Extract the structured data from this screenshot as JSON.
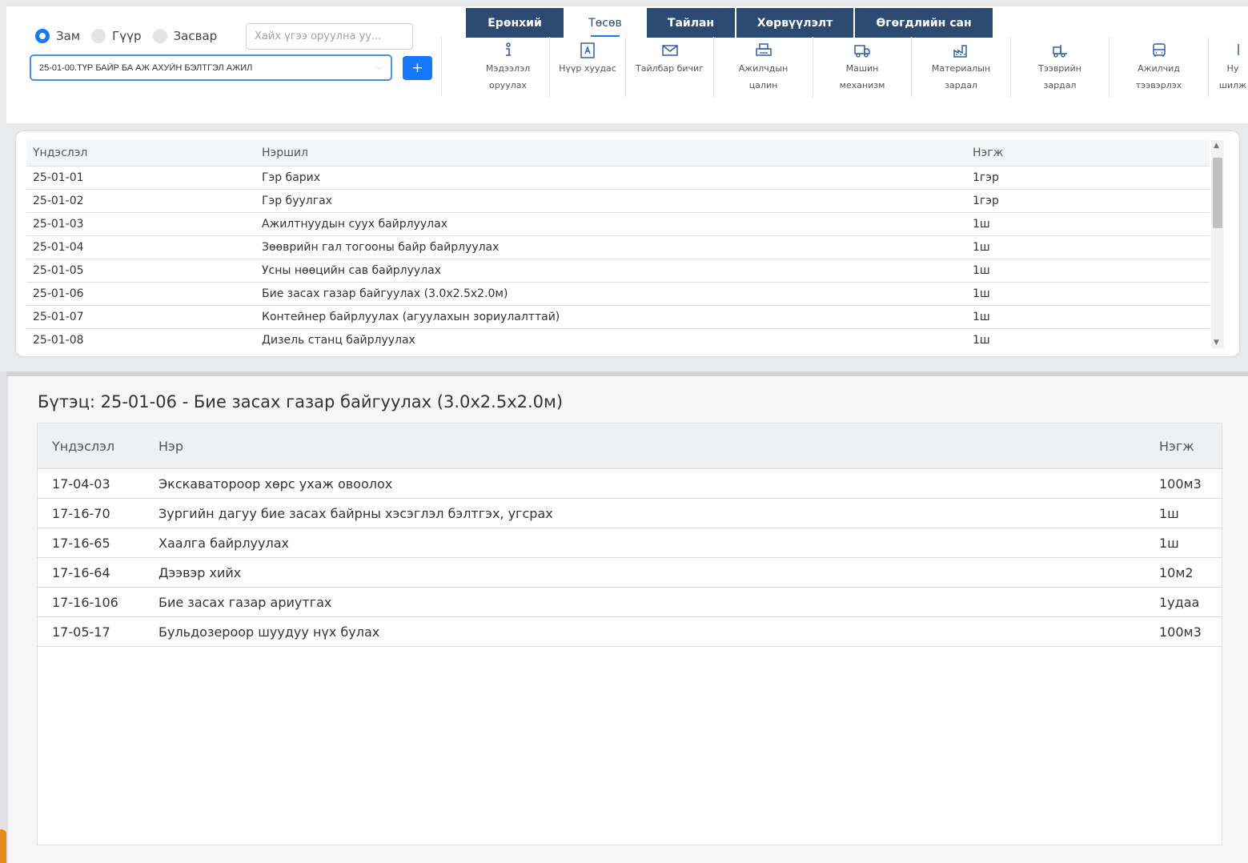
{
  "filters": {
    "radios": [
      {
        "label": "Зам",
        "checked": true
      },
      {
        "label": "Гүүр",
        "checked": false
      },
      {
        "label": "Засвар",
        "checked": false
      }
    ],
    "search_placeholder": "Хайх үгээ оруулна уу...",
    "selected_project": "25-01-00.ТҮР БАЙР БА АЖ АХУЙН БЭЛТГЭЛ АЖИЛ",
    "add_label": "+"
  },
  "tabs": [
    {
      "label": "Ерөнхий",
      "active": false
    },
    {
      "label": "Төсөв",
      "active": true
    },
    {
      "label": "Тайлан",
      "active": false
    },
    {
      "label": "Хөрвүүлэлт",
      "active": false
    },
    {
      "label": "Өгөгдлийн сан",
      "active": false
    }
  ],
  "tools": [
    {
      "label": "Мэдээлэл\nоруулах",
      "icon": "info-icon"
    },
    {
      "label": "Нүүр хуудас",
      "icon": "cover-page-icon"
    },
    {
      "label": "Тайлбар бичиг",
      "icon": "envelope-icon"
    },
    {
      "label": "Ажилчдын\nцалин",
      "icon": "printer-icon"
    },
    {
      "label": "Машин\nмеханизм",
      "icon": "truck-icon"
    },
    {
      "label": "Материалын\nзардал",
      "icon": "factory-icon"
    },
    {
      "label": "Тээврийн\nзардал",
      "icon": "forklift-icon"
    },
    {
      "label": "Ажилчид\nтээвэрлэх",
      "icon": "bus-icon"
    },
    {
      "label": "Ну\nшилж",
      "icon": "transfer-icon"
    }
  ],
  "works_table": {
    "headers": [
      "Үндэслэл",
      "Нэршил",
      "Нэгж"
    ],
    "rows": [
      [
        "25-01-01",
        "Гэр барих",
        "1гэр"
      ],
      [
        "25-01-02",
        "Гэр буулгах",
        "1гэр"
      ],
      [
        "25-01-03",
        "Ажилтнуудын суух байрлуулах",
        "1ш"
      ],
      [
        "25-01-04",
        "Зөөврийн гал тогооны байр байрлуулах",
        "1ш"
      ],
      [
        "25-01-05",
        "Усны нөөцийн сав байрлуулах",
        "1ш"
      ],
      [
        "25-01-06",
        "Бие засах газар байгуулах (3.0x2.5x2.0м)",
        "1ш"
      ],
      [
        "25-01-07",
        "Контейнер байрлуулах (агуулахын зориулалттай)",
        "1ш"
      ],
      [
        "25-01-08",
        "Дизель станц байрлуулах",
        "1ш"
      ]
    ]
  },
  "structure": {
    "title": "Бүтэц: 25-01-06 - Бие засах газар байгуулах (3.0x2.5x2.0м)",
    "headers": [
      "Үндэслэл",
      "Нэр",
      "Нэгж"
    ],
    "rows": [
      [
        "17-04-03",
        "Экскаватороор хөрс ухаж овоолох",
        "100м3"
      ],
      [
        "17-16-70",
        "Зургийн дагуу бие засах байрны хэсэглэл бэлтгэх, угсрах",
        "1ш"
      ],
      [
        "17-16-65",
        "Хаалга байрлуулах",
        "1ш"
      ],
      [
        "17-16-64",
        "Дээвэр хийх",
        "10м2"
      ],
      [
        "17-16-106",
        "Бие засах газар ариутгах",
        "1удаа"
      ],
      [
        "17-05-17",
        "Бульдозероор шуудуу нүх булах",
        "100м3"
      ]
    ]
  },
  "colors": {
    "tab_bg": "#2d4a73",
    "accent": "#1677ff",
    "icon": "#2f5ea8"
  }
}
